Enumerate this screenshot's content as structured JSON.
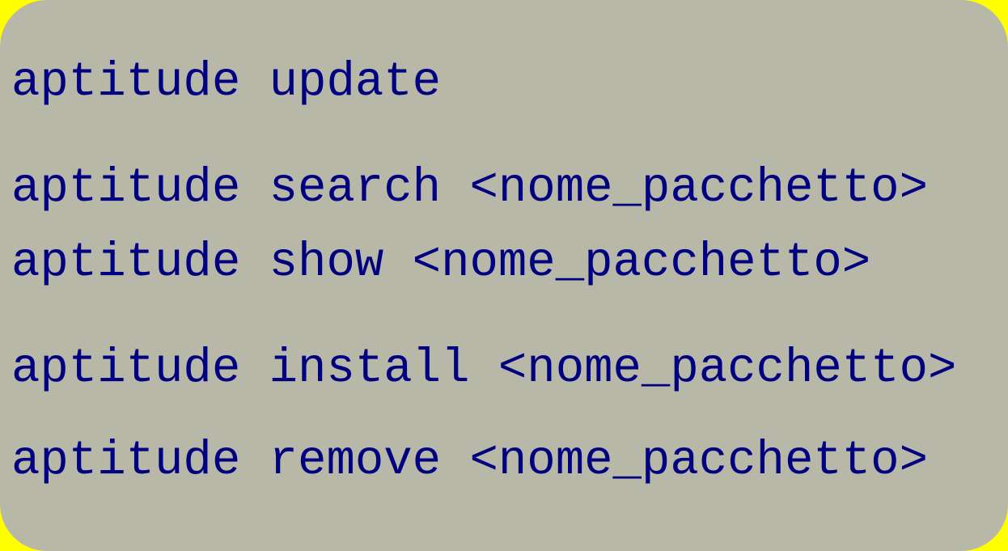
{
  "colors": {
    "frame": "#ffff00",
    "panel": "#b8b8a8",
    "text": "#000080"
  },
  "commands": [
    "aptitude update",
    "aptitude search <nome_pacchetto>",
    "aptitude show <nome_pacchetto>",
    "aptitude install <nome_pacchetto>",
    "aptitude remove <nome_pacchetto>"
  ]
}
